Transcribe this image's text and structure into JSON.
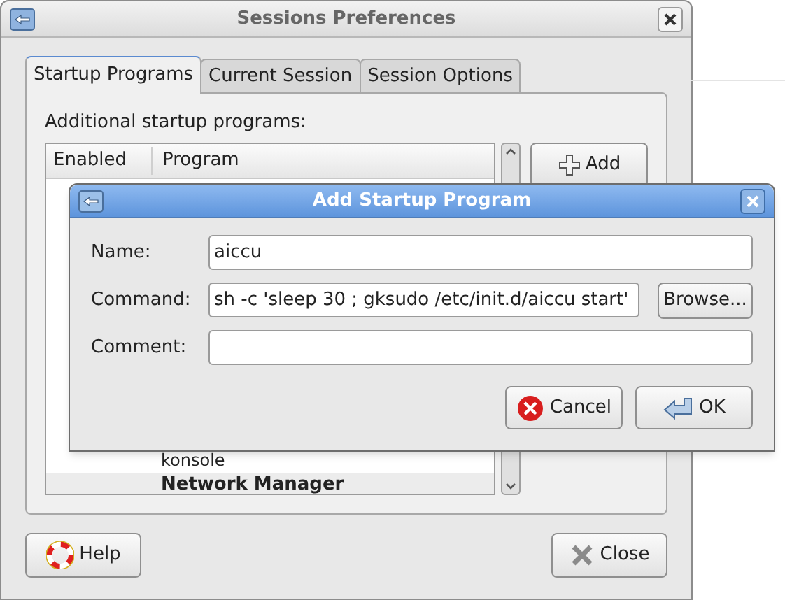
{
  "window": {
    "title": "Sessions Preferences"
  },
  "tabs": [
    {
      "label": "Startup Programs",
      "selected": true
    },
    {
      "label": "Current Session",
      "selected": false
    },
    {
      "label": "Session Options",
      "selected": false
    }
  ],
  "list_label": "Additional startup programs:",
  "table": {
    "columns": [
      "Enabled",
      "Program"
    ],
    "rows": [
      {
        "kind": "detail",
        "text": "konsole"
      },
      {
        "kind": "title",
        "text": "Network Manager"
      }
    ]
  },
  "add_button": "Add",
  "buttons": {
    "help": "Help",
    "close": "Close"
  },
  "dialog": {
    "title": "Add Startup Program",
    "fields": [
      {
        "label": "Name:",
        "value": "aiccu"
      },
      {
        "label": "Command:",
        "value": "sh -c 'sleep 30 ; gksudo /etc/init.d/aiccu start'",
        "browse": "Browse..."
      },
      {
        "label": "Comment:"
      }
    ],
    "cancel": "Cancel",
    "ok": "OK"
  }
}
